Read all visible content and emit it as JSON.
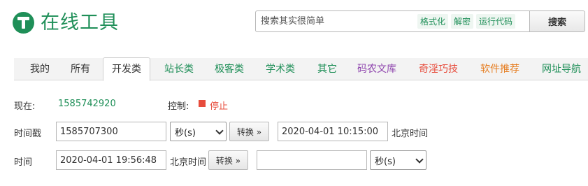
{
  "header": {
    "logo_text": "在线工具",
    "search": {
      "placeholder": "搜索其实很简单",
      "quick_links": [
        "格式化",
        "解密",
        "运行代码"
      ],
      "button_label": "搜索"
    }
  },
  "nav": {
    "tabs": [
      {
        "label": "我的",
        "color": "#333333"
      },
      {
        "label": "所有",
        "color": "#333333"
      },
      {
        "label": "开发类",
        "color": "#333333",
        "active": true
      },
      {
        "label": "站长类",
        "color": "#1f8f58"
      },
      {
        "label": "极客类",
        "color": "#1f8f58"
      },
      {
        "label": "学术类",
        "color": "#1f8f58"
      },
      {
        "label": "其它",
        "color": "#1f8f58"
      },
      {
        "label": "码农文库",
        "color": "#8e44ad"
      },
      {
        "label": "奇淫巧技",
        "color": "#e74c3c"
      },
      {
        "label": "软件推荐",
        "color": "#e67e22"
      },
      {
        "label": "网址导航",
        "color": "#1f8f58"
      }
    ]
  },
  "now": {
    "label": "现在:",
    "value": "1585742920",
    "control_label": "控制:",
    "stop_label": "停止",
    "stop_color": "#e74c3c"
  },
  "timestamp_row": {
    "label": "时间戳",
    "input_value": "1585707300",
    "unit": "秒(s)",
    "convert_label": "转换 »",
    "output_value": "2020-04-01 10:15:00",
    "zone": "北京时间"
  },
  "time_row": {
    "label": "时间",
    "input_value": "2020-04-01 19:56:48",
    "zone": "北京时间",
    "convert_label": "转换 »",
    "output_value": "",
    "unit": "秒(s)"
  }
}
